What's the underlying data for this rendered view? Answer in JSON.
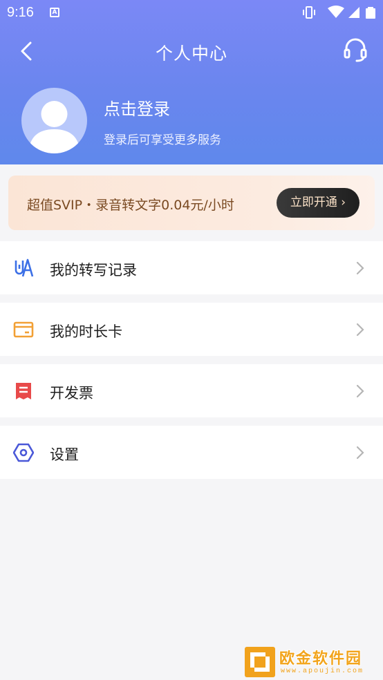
{
  "status_bar": {
    "time": "9:16",
    "notification_icon": "A"
  },
  "nav": {
    "title": "个人中心"
  },
  "profile": {
    "login_title": "点击登录",
    "login_subtitle": "登录后可享受更多服务"
  },
  "banner": {
    "text": "超值SVIP・录音转文字0.04元/小时",
    "button_label": "立即开通 ›"
  },
  "menu": {
    "items": [
      {
        "label": "我的转写记录",
        "icon": "transcript-icon",
        "color": "#3b6fe6"
      },
      {
        "label": "我的时长卡",
        "icon": "card-icon",
        "color": "#f2a035"
      },
      {
        "label": "开发票",
        "icon": "receipt-icon",
        "color": "#e84a4a"
      },
      {
        "label": "设置",
        "icon": "settings-hexagon-icon",
        "color": "#4a58d8"
      }
    ]
  },
  "watermark": {
    "text": "欧金软件园",
    "url": "www.apoujin.com"
  },
  "colors": {
    "header_top": "#7b88f6",
    "header_bottom": "#5f88ec",
    "background": "#f5f5f7",
    "banner_text": "#7a4a22"
  }
}
